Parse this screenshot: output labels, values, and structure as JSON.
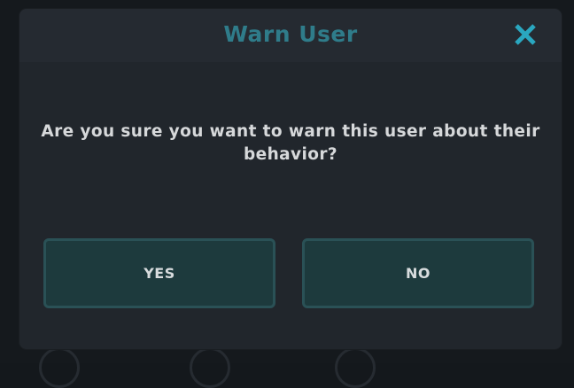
{
  "dialog": {
    "title": "Warn User",
    "message": "Are you sure you want to warn this user about their behavior?",
    "close_icon": "close-icon",
    "yes_label": "YES",
    "no_label": "NO"
  },
  "colors": {
    "title": "#2f7c8a",
    "close": "#2aa7c0",
    "button_bg": "#1d3a3d",
    "button_border": "#2a5156",
    "panel_bg": "#22272d"
  }
}
